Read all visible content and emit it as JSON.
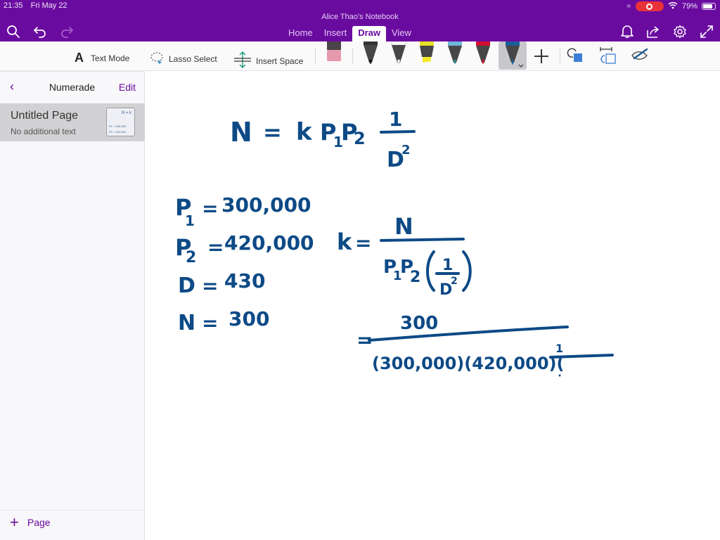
{
  "status_bar": {
    "time": "21:35",
    "date": "Fri May 22",
    "battery_percent": "79%",
    "battery_level": 0.79
  },
  "app": {
    "notebook_title": "Alice Thao's Notebook",
    "tabs": [
      {
        "label": "Home",
        "active": false
      },
      {
        "label": "Insert",
        "active": false
      },
      {
        "label": "Draw",
        "active": true
      },
      {
        "label": "View",
        "active": false
      }
    ],
    "accent_color": "#6a0ba0"
  },
  "toolbar": {
    "text_mode_label": "Text Mode",
    "lasso_select_label": "Lasso Select",
    "insert_space_label": "Insert Space",
    "pens": [
      {
        "name": "black-pen",
        "color": "#111111"
      },
      {
        "name": "white-pen",
        "color": "#ffffff"
      },
      {
        "name": "yellow-highlighter",
        "color": "#f4ea2a"
      },
      {
        "name": "teal-pen",
        "color": "#2f8f8a"
      },
      {
        "name": "red-pen",
        "color": "#d0102e"
      },
      {
        "name": "blue-pen",
        "color": "#1d5e96",
        "selected": true
      }
    ]
  },
  "sidebar": {
    "section_title": "Numerade",
    "edit_label": "Edit",
    "pages": [
      {
        "title": "Untitled Page",
        "subtitle": "No additional text",
        "selected": true,
        "thumb_lines": [
          "N = k",
          "P1 = 300,000",
          "P2 = 420,000"
        ]
      }
    ],
    "add_page_label": "Page"
  },
  "note": {
    "ink_color": "#0d4a86",
    "formula_main": {
      "lhs": "N",
      "eq": "=",
      "k": "k",
      "p1": "P",
      "p1_sub": "1",
      "p2": "P",
      "p2_sub": "2",
      "num": "1",
      "den": "D",
      "den_sup": "2"
    },
    "givens": [
      {
        "var": "P",
        "sub": "1",
        "value": "300,000"
      },
      {
        "var": "P",
        "sub": "2",
        "value": "420,000"
      },
      {
        "var": "D",
        "sub": "",
        "value": "430"
      },
      {
        "var": "N",
        "sub": "",
        "value": "300"
      }
    ],
    "k_formula": {
      "lhs": "k",
      "eq": "=",
      "num": "N",
      "den_p1": "P",
      "den_p1_sub": "1",
      "den_p2": "P",
      "den_p2_sub": "2",
      "inner_num": "1",
      "inner_den": "D",
      "inner_den_sup": "2"
    },
    "substitution": {
      "eq": "=",
      "num": "300",
      "den": "(300,000)(420,000)(",
      "tail_num": "1"
    }
  }
}
